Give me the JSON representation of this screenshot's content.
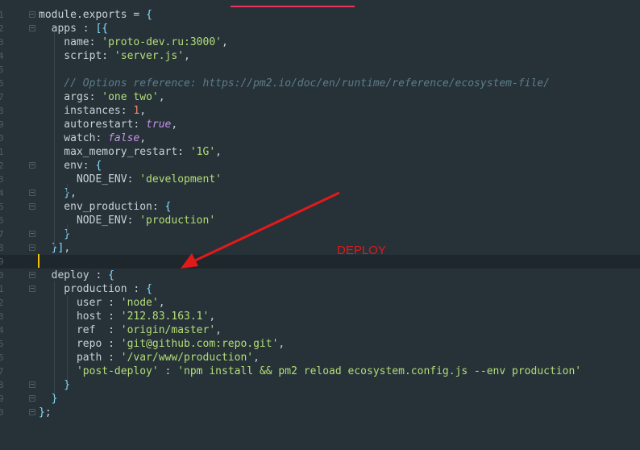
{
  "annotation": {
    "label": "DEPLOY",
    "color": "#e01a1a"
  },
  "lines": [
    {
      "n": "1",
      "tokens": [
        [
          "t-kw",
          "module.exports = "
        ],
        [
          "t-punc",
          "{"
        ]
      ]
    },
    {
      "n": "2",
      "tokens": [
        [
          "t-kw",
          "  apps : "
        ],
        [
          "t-punc",
          "[{"
        ]
      ]
    },
    {
      "n": "3",
      "tokens": [
        [
          "t-kw",
          "    name: "
        ],
        [
          "t-str",
          "'proto-dev.ru:3000'"
        ],
        [
          "t-kw",
          ","
        ]
      ]
    },
    {
      "n": "4",
      "tokens": [
        [
          "t-kw",
          "    script: "
        ],
        [
          "t-str",
          "'server.js'"
        ],
        [
          "t-kw",
          ","
        ]
      ]
    },
    {
      "n": "5",
      "tokens": []
    },
    {
      "n": "6",
      "tokens": [
        [
          "t-com",
          "    // Options reference: https://pm2.io/doc/en/runtime/reference/ecosystem-file/"
        ]
      ]
    },
    {
      "n": "7",
      "tokens": [
        [
          "t-kw",
          "    args: "
        ],
        [
          "t-str",
          "'one two'"
        ],
        [
          "t-kw",
          ","
        ]
      ]
    },
    {
      "n": "8",
      "tokens": [
        [
          "t-kw",
          "    instances: "
        ],
        [
          "t-num",
          "1"
        ],
        [
          "t-kw",
          ","
        ]
      ]
    },
    {
      "n": "9",
      "tokens": [
        [
          "t-kw",
          "    autorestart: "
        ],
        [
          "t-bool",
          "true"
        ],
        [
          "t-kw",
          ","
        ]
      ]
    },
    {
      "n": "0",
      "tokens": [
        [
          "t-kw",
          "    watch: "
        ],
        [
          "t-bool",
          "false"
        ],
        [
          "t-kw",
          ","
        ]
      ]
    },
    {
      "n": "1",
      "tokens": [
        [
          "t-kw",
          "    max_memory_restart: "
        ],
        [
          "t-str",
          "'1G'"
        ],
        [
          "t-kw",
          ","
        ]
      ]
    },
    {
      "n": "2",
      "tokens": [
        [
          "t-kw",
          "    env: "
        ],
        [
          "t-punc",
          "{"
        ]
      ]
    },
    {
      "n": "3",
      "tokens": [
        [
          "t-kw",
          "      NODE_ENV: "
        ],
        [
          "t-str",
          "'development'"
        ]
      ]
    },
    {
      "n": "4",
      "tokens": [
        [
          "t-punc",
          "    }"
        ],
        [
          "t-kw",
          ","
        ]
      ]
    },
    {
      "n": "5",
      "tokens": [
        [
          "t-kw",
          "    env_production: "
        ],
        [
          "t-punc",
          "{"
        ]
      ]
    },
    {
      "n": "6",
      "tokens": [
        [
          "t-kw",
          "      NODE_ENV: "
        ],
        [
          "t-str",
          "'production'"
        ]
      ]
    },
    {
      "n": "7",
      "tokens": [
        [
          "t-punc",
          "    }"
        ]
      ]
    },
    {
      "n": "8",
      "tokens": [
        [
          "t-punc",
          "  }]"
        ],
        [
          "t-kw",
          ","
        ]
      ]
    },
    {
      "n": "9",
      "tokens": []
    },
    {
      "n": "0",
      "tokens": [
        [
          "t-kw",
          "  deploy : "
        ],
        [
          "t-punc",
          "{"
        ]
      ]
    },
    {
      "n": "1",
      "tokens": [
        [
          "t-kw",
          "    production : "
        ],
        [
          "t-punc",
          "{"
        ]
      ]
    },
    {
      "n": "2",
      "tokens": [
        [
          "t-kw",
          "      user : "
        ],
        [
          "t-str",
          "'node'"
        ],
        [
          "t-kw",
          ","
        ]
      ]
    },
    {
      "n": "3",
      "tokens": [
        [
          "t-kw",
          "      host : "
        ],
        [
          "t-str",
          "'212.83.163.1'"
        ],
        [
          "t-kw",
          ","
        ]
      ]
    },
    {
      "n": "4",
      "tokens": [
        [
          "t-kw",
          "      ref  : "
        ],
        [
          "t-str",
          "'origin/master'"
        ],
        [
          "t-kw",
          ","
        ]
      ]
    },
    {
      "n": "5",
      "tokens": [
        [
          "t-kw",
          "      repo : "
        ],
        [
          "t-str",
          "'git@github.com:repo.git'"
        ],
        [
          "t-kw",
          ","
        ]
      ]
    },
    {
      "n": "6",
      "tokens": [
        [
          "t-kw",
          "      path : "
        ],
        [
          "t-str",
          "'/var/www/production'"
        ],
        [
          "t-kw",
          ","
        ]
      ]
    },
    {
      "n": "7",
      "tokens": [
        [
          "t-str",
          "      'post-deploy'"
        ],
        [
          "t-kw",
          " : "
        ],
        [
          "t-str",
          "'npm install && pm2 reload ecosystem.config.js --env production'"
        ]
      ]
    },
    {
      "n": "8",
      "tokens": [
        [
          "t-punc",
          "    }"
        ]
      ]
    },
    {
      "n": "9",
      "tokens": [
        [
          "t-punc",
          "  }"
        ]
      ]
    },
    {
      "n": "0",
      "tokens": [
        [
          "t-punc",
          "}"
        ],
        [
          "t-kw",
          ";"
        ]
      ]
    }
  ],
  "fold_markers": [
    1,
    2,
    12,
    14,
    15,
    17,
    18,
    20,
    21,
    28,
    29,
    30
  ],
  "current_line": 19
}
